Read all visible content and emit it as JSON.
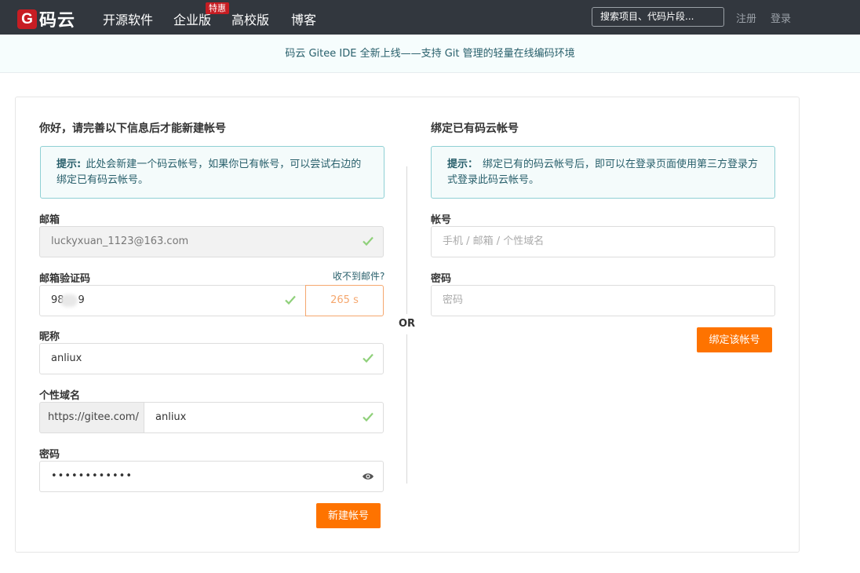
{
  "nav": {
    "logo_letter": "G",
    "logo_text": "码云",
    "items": [
      "开源软件",
      "企业版",
      "高校版",
      "博客"
    ],
    "badge": "特惠",
    "search_placeholder": "搜索项目、代码片段...",
    "register": "注册",
    "login": "登录"
  },
  "banner": {
    "text": "码云 Gitee IDE 全新上线——支持 Git 管理的轻量在线编码环境"
  },
  "left": {
    "title": "你好，请完善以下信息后才能新建帐号",
    "tip_label": "提示:",
    "tip_text": "此处会新建一个码云帐号，如果你已有帐号，可以尝试右边的绑定已有码云帐号。",
    "email_label": "邮箱",
    "email_value": "luckyxuan_1123@163.com",
    "code_label": "邮箱验证码",
    "code_help": "收不到邮件?",
    "code_value_start": "98",
    "code_value_end": "9",
    "countdown": "265 s",
    "nickname_label": "昵称",
    "nickname_value": "anliux",
    "domain_label": "个性域名",
    "domain_prefix": "https://gitee.com/",
    "domain_value": "anliux",
    "password_label": "密码",
    "password_value": "••••••••••••",
    "submit": "新建帐号"
  },
  "divider": {
    "or": "OR"
  },
  "right": {
    "title": "绑定已有码云帐号",
    "tip_label": "提示：",
    "tip_text": "绑定已有的码云帐号后，即可以在登录页面使用第三方登录方式登录此码云帐号。",
    "account_label": "帐号",
    "account_placeholder": "手机 / 邮箱 / 个性域名",
    "password_label": "密码",
    "password_placeholder": "密码",
    "submit": "绑定该帐号"
  },
  "colors": {
    "nav_bg": "#32373e",
    "brand_red": "#c71d23",
    "accent_orange": "#fe7300",
    "check_green": "#8fd07a"
  }
}
